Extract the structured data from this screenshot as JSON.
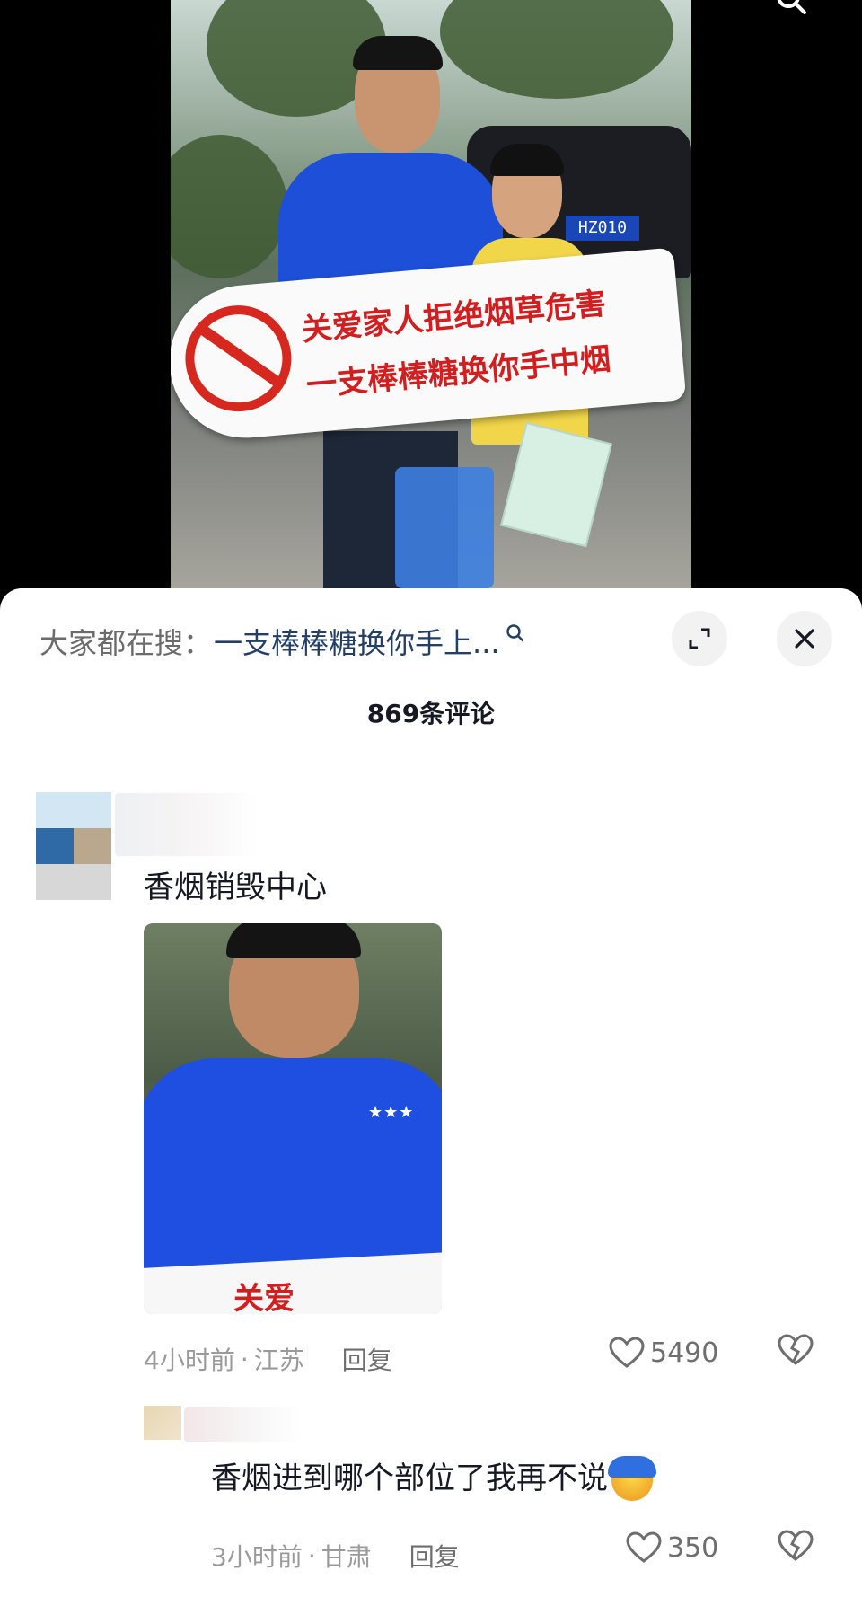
{
  "video": {
    "sign_line1": "关爱家人拒绝烟草危害",
    "sign_line2": "一支棒棒糖换你手中烟",
    "plate": "HZ010",
    "shirt_stars": "★★★"
  },
  "search_bar": {
    "prefix": "大家都在搜：",
    "query": "一支棒棒糖换你手上...",
    "icon": "search-icon"
  },
  "buttons": {
    "expand_icon": "expand-icon",
    "close_icon": "close-icon"
  },
  "comments_header": {
    "count_label": "869条评论"
  },
  "comments": [
    {
      "text": "香烟销毁中心",
      "image_sign_text": "关爱",
      "time": "4小时前",
      "location": "江苏",
      "reply_label": "回复",
      "likes": "5490"
    },
    {
      "text": "香烟进到哪个部位了我再不说",
      "time": "3小时前",
      "location": "甘肃",
      "reply_label": "回复",
      "likes": "350"
    }
  ],
  "colors": {
    "accent_link": "#233f66",
    "sign_red": "#d21e1e",
    "shirt_blue": "#1e4fd8"
  }
}
